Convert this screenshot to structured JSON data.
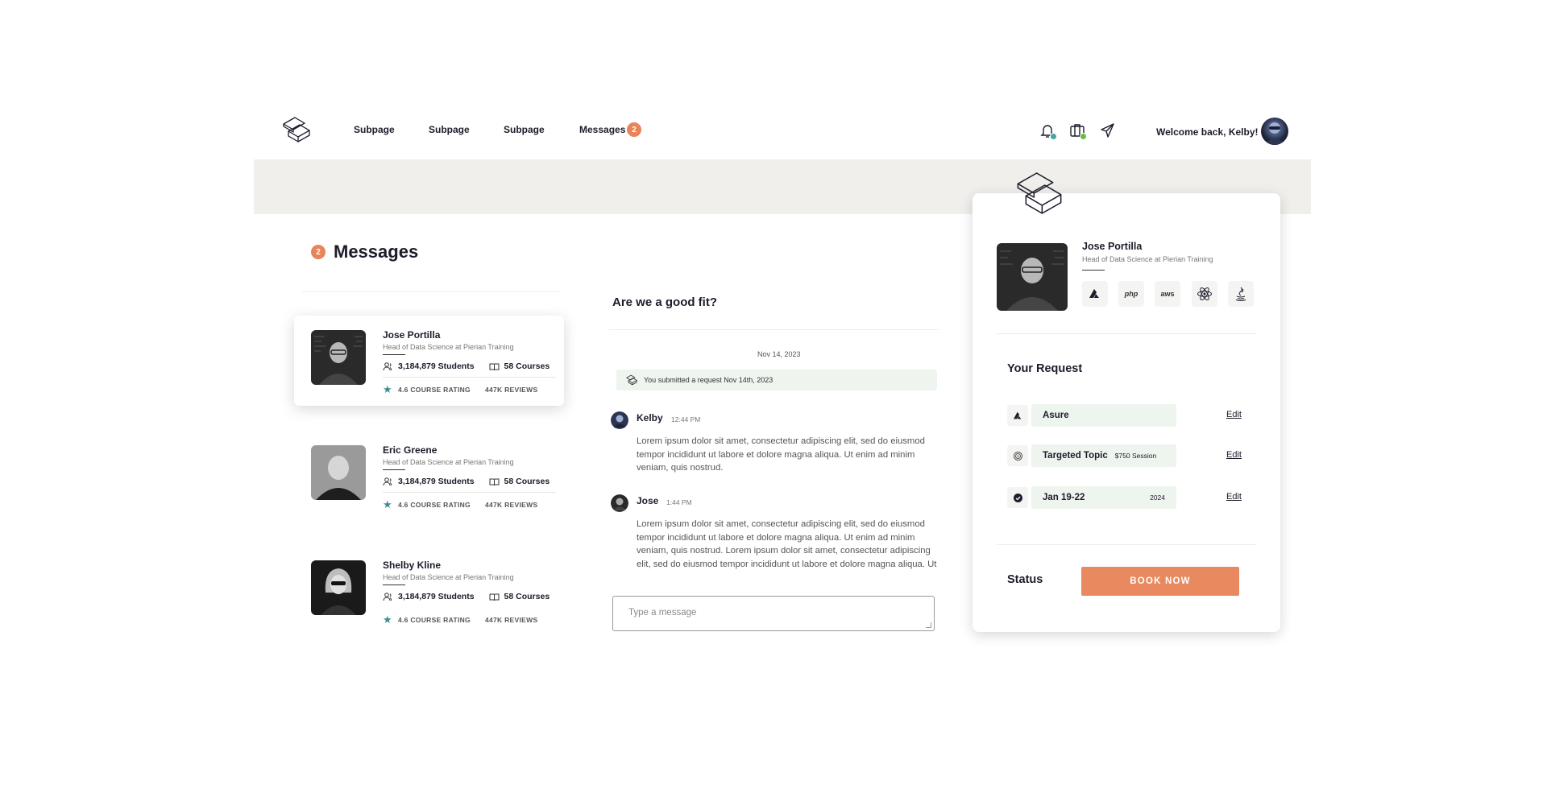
{
  "nav": {
    "links": [
      "Subpage",
      "Subpage",
      "Subpage"
    ],
    "messages_label": "Messages",
    "messages_count": "2",
    "welcome": "Welcome back, Kelby!",
    "icons": [
      "bell-icon",
      "briefcase-icon",
      "send-icon"
    ]
  },
  "messages": {
    "title": "Messages",
    "count": "2"
  },
  "contacts": [
    {
      "name": "Jose Portilla",
      "role": "Head of Data Science at Pierian Training",
      "students": "3,184,879 Students",
      "courses": "58 Courses",
      "rating": "4.6 COURSE RATING",
      "reviews": "447K REVIEWS"
    },
    {
      "name": "Eric Greene",
      "role": "Head of Data Science at Pierian Training",
      "students": "3,184,879 Students",
      "courses": "58 Courses",
      "rating": "4.6 COURSE RATING",
      "reviews": "447K REVIEWS"
    },
    {
      "name": "Shelby Kline",
      "role": "Head of Data Science at Pierian Training",
      "students": "3,184,879 Students",
      "courses": "58 Courses",
      "rating": "4.6 COURSE RATING",
      "reviews": "447K REVIEWS"
    }
  ],
  "chat": {
    "title": "Are we a good fit?",
    "date": "Nov 14, 2023",
    "notice": "You submitted a request Nov 14th, 2023",
    "messages": [
      {
        "sender": "Kelby",
        "time": "12:44 PM",
        "text": "Lorem ipsum dolor sit amet, consectetur adipiscing elit, sed do eiusmod tempor incididunt ut labore et dolore magna aliqua. Ut enim ad minim veniam, quis nostrud."
      },
      {
        "sender": "Jose",
        "time": "1:44 PM",
        "text": "Lorem ipsum dolor sit amet, consectetur adipiscing elit, sed do eiusmod tempor incididunt ut labore et dolore magna aliqua. Ut enim ad minim veniam, quis nostrud. Lorem ipsum dolor sit amet, consectetur adipiscing elit, sed do eiusmod tempor incididunt ut labore et dolore magna aliqua. Ut"
      }
    ],
    "placeholder": "Type a message"
  },
  "card": {
    "name": "Jose Portilla",
    "role": "Head of Data Science at Pierian Training",
    "tech": [
      "azure-icon",
      "php",
      "aws",
      "react-icon",
      "java-icon"
    ],
    "tech_labels": {
      "php": "php",
      "aws": "aws"
    },
    "request_title": "Your Request",
    "requests": [
      {
        "icon": "azure-icon",
        "value": "Asure",
        "extra": "",
        "edit": "Edit"
      },
      {
        "icon": "topic-icon",
        "value": "Targeted Topic",
        "extra": "$750 Session",
        "edit": "Edit"
      },
      {
        "icon": "check-icon",
        "value": "Jan 19-22",
        "extra": "2024",
        "edit": "Edit"
      }
    ],
    "status_label": "Status",
    "book_label": "BOOK NOW"
  },
  "colors": {
    "accent": "#e8845a",
    "teal": "#3e8b8b",
    "band": "#f0efec",
    "field": "#eef4ee"
  }
}
